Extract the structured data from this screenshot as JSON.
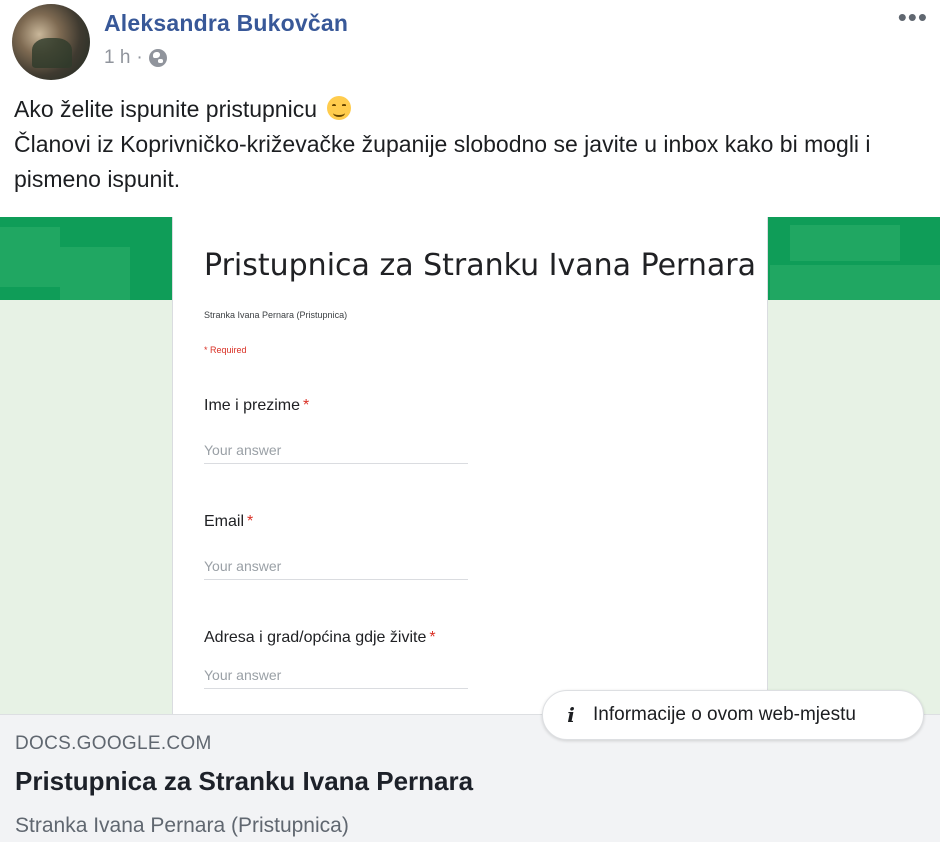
{
  "post": {
    "author": "Aleksandra Bukovčan",
    "time": "1 h",
    "separator": "·",
    "text_line1": "Ako želite ispunite pristupnicu",
    "text_line2": "Članovi iz Koprivničko-križevačke županije slobodno se javite u inbox kako bi mogli i pismeno ispunit."
  },
  "form_preview": {
    "title": "Pristupnica za Stranku Ivana Pernara",
    "description": "Stranka Ivana Pernara (Pristupnica)",
    "required_note": "* Required",
    "questions": [
      {
        "label": "Ime i prezime",
        "required_mark": "*",
        "placeholder": "Your answer"
      },
      {
        "label": "Email",
        "required_mark": "*",
        "placeholder": "Your answer"
      },
      {
        "label": "Adresa i grad/općina gdje živite",
        "required_mark": "*",
        "placeholder": "Your answer"
      }
    ]
  },
  "info_button": {
    "icon": "i",
    "label": "Informacije o ovom web-mjestu"
  },
  "link": {
    "domain": "DOCS.GOOGLE.COM",
    "title": "Pristupnica za Stranku Ivana Pernara",
    "description": "Stranka Ivana Pernara (Pristupnica)"
  },
  "icons": {
    "more": "more-options-icon",
    "globe": "globe-icon",
    "emoji": "smiling-face-icon",
    "info": "info-icon"
  },
  "colors": {
    "author": "#385898",
    "form_green": "#0f9d58",
    "required_red": "#d93025",
    "footer_bg": "#f2f3f5"
  }
}
